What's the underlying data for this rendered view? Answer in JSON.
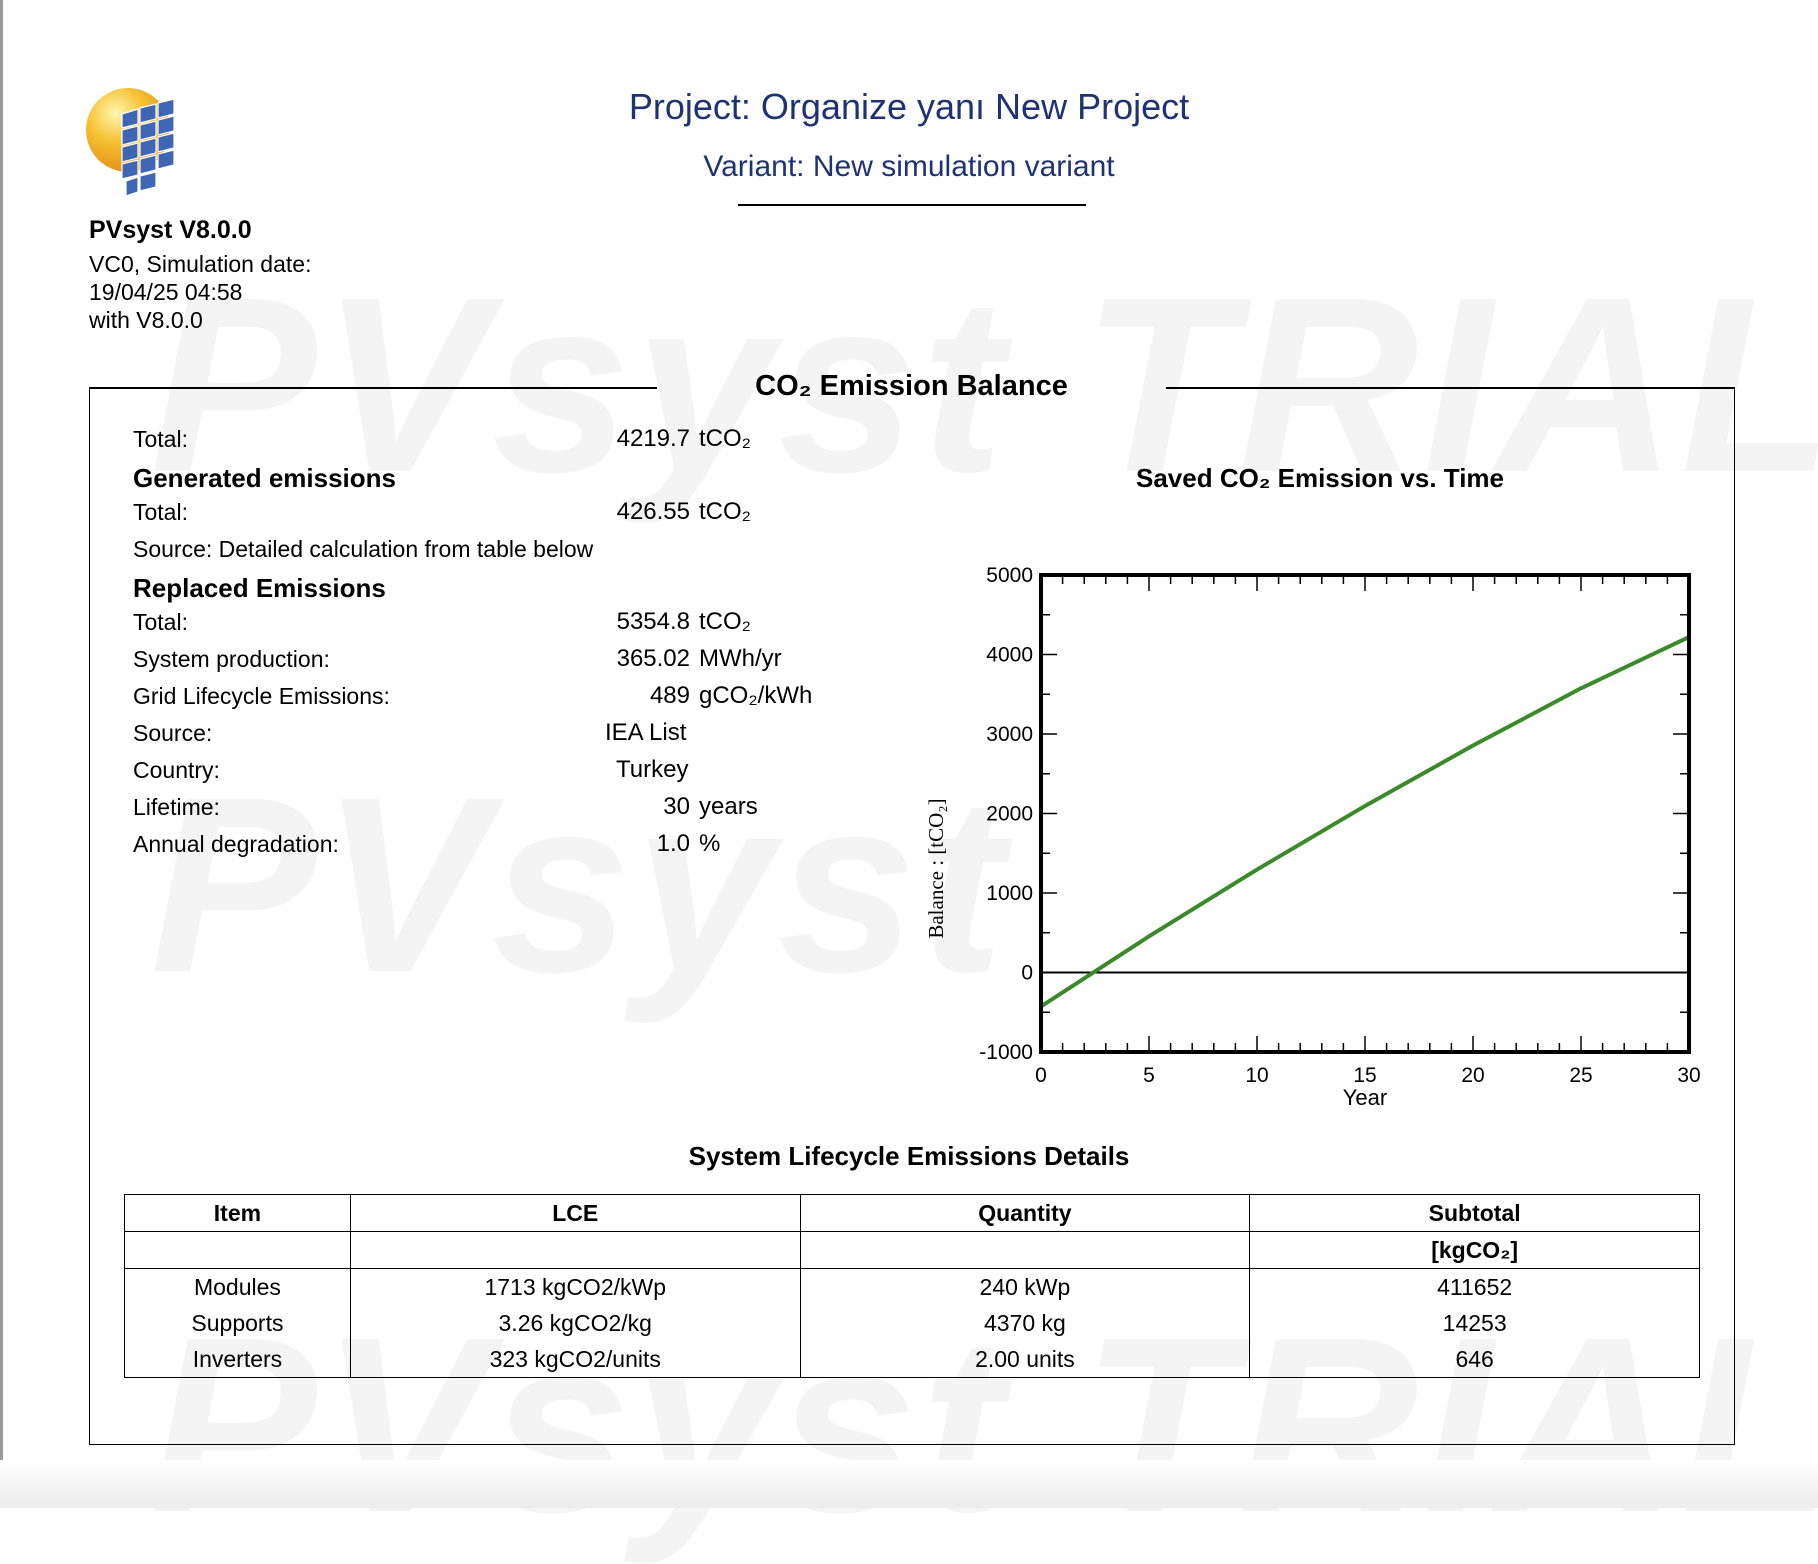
{
  "watermark": "PVsyst TRIAL",
  "watermark_short": "PVsyst",
  "software": {
    "name": "PVsyst V8.0.0",
    "info_lines": [
      "VC0, Simulation date:",
      "19/04/25 04:58",
      "with V8.0.0"
    ]
  },
  "header": {
    "project": "Project: Organize yanı New Project",
    "variant": "Variant: New simulation variant"
  },
  "section_title": "CO₂ Emission Balance",
  "balance": {
    "total_label": "Total:",
    "total_value": "4219.7",
    "total_unit": "tCO₂",
    "generated_heading": "Generated emissions",
    "generated_total_label": "Total:",
    "generated_total_value": "426.55",
    "generated_total_unit": "tCO₂",
    "generated_source": "Source: Detailed calculation from table below",
    "replaced_heading": "Replaced Emissions",
    "replaced_total_label": "Total:",
    "replaced_total_value": "5354.8",
    "replaced_total_unit": "tCO₂",
    "system_production_label": "System production:",
    "system_production_value": "365.02",
    "system_production_unit": "MWh/yr",
    "grid_label": "Grid Lifecycle Emissions:",
    "grid_value": "489",
    "grid_unit": "gCO₂/kWh",
    "source_label": "Source:",
    "source_value": "IEA List",
    "country_label": "Country:",
    "country_value": "Turkey",
    "lifetime_label": "Lifetime:",
    "lifetime_value": "30",
    "lifetime_unit": "years",
    "degradation_label": "Annual degradation:",
    "degradation_value": "1.0",
    "degradation_unit": "%"
  },
  "chart_data": {
    "type": "line",
    "title": "Saved CO₂ Emission vs. Time",
    "xlabel": "Year",
    "ylabel": "Balance : [tCO₂]",
    "xlim": [
      0,
      30
    ],
    "ylim": [
      -1000,
      5000
    ],
    "x_ticks": [
      0,
      5,
      10,
      15,
      20,
      25,
      30
    ],
    "y_ticks": [
      -1000,
      0,
      1000,
      2000,
      3000,
      4000,
      5000
    ],
    "grid": false,
    "series": [
      {
        "color": "#3a8a2a",
        "x": [
          0,
          5,
          10,
          15,
          20,
          25,
          30
        ],
        "y": [
          -427,
          455,
          1295,
          2095,
          2855,
          3575,
          4220
        ]
      }
    ]
  },
  "lce_table": {
    "title": "System Lifecycle Emissions Details",
    "headers": [
      "Item",
      "LCE",
      "Quantity",
      "Subtotal"
    ],
    "subtotal_unit": "[kgCO₂]",
    "rows": [
      [
        "Modules",
        "1713 kgCO2/kWp",
        "240 kWp",
        "411652"
      ],
      [
        "Supports",
        "3.26 kgCO2/kg",
        "4370 kg",
        "14253"
      ],
      [
        "Inverters",
        "323 kgCO2/units",
        "2.00 units",
        "646"
      ]
    ]
  }
}
